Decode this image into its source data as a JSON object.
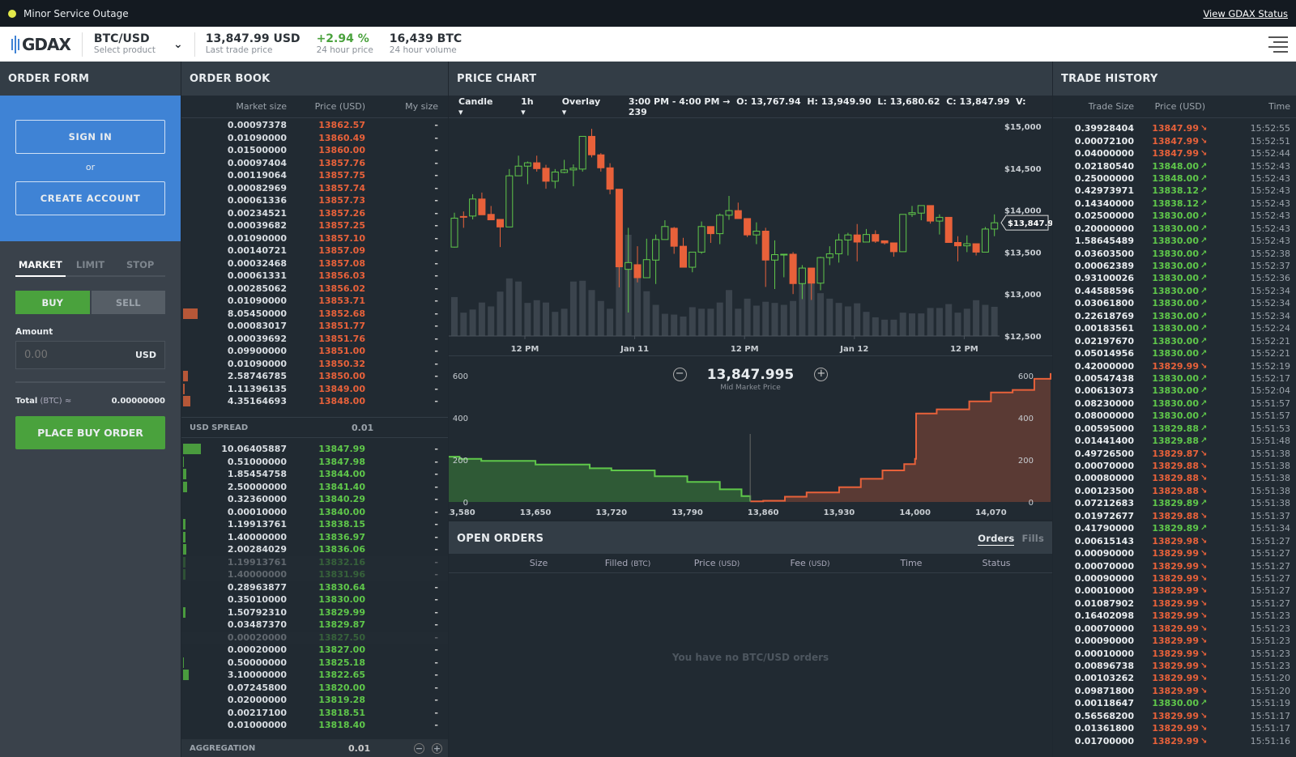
{
  "status": {
    "text": "Minor Service Outage",
    "link": "View GDAX Status",
    "dot_color": "#e3e94a"
  },
  "header": {
    "logo": "GDAX",
    "product": "BTC/USD",
    "product_sub": "Select product",
    "stats": [
      {
        "value": "13,847.99 USD",
        "label": "Last trade price"
      },
      {
        "value": "+2.94 %",
        "label": "24 hour price",
        "color": "#4aa23d"
      },
      {
        "value": "16,439 BTC",
        "label": "24 hour volume"
      }
    ]
  },
  "order_form": {
    "title": "ORDER FORM",
    "sign_in": "SIGN IN",
    "or": "or",
    "create_account": "CREATE ACCOUNT",
    "tabs": [
      "MARKET",
      "LIMIT",
      "STOP"
    ],
    "buy": "BUY",
    "sell": "SELL",
    "amount_label": "Amount",
    "amount_placeholder": "0.00",
    "amount_unit": "USD",
    "total_label": "Total",
    "total_unit": "(BTC) ≈",
    "total_value": "0.00000000",
    "place": "PLACE BUY ORDER"
  },
  "order_book": {
    "title": "ORDER BOOK",
    "headers": [
      "Market size",
      "Price (USD)",
      "My size"
    ],
    "asks": [
      {
        "size": "0.00097378",
        "price": "13862.57"
      },
      {
        "size": "0.01090000",
        "price": "13860.49"
      },
      {
        "size": "0.01500000",
        "price": "13860.00"
      },
      {
        "size": "0.00097404",
        "price": "13857.76"
      },
      {
        "size": "0.00119064",
        "price": "13857.75"
      },
      {
        "size": "0.00082969",
        "price": "13857.74"
      },
      {
        "size": "0.00061336",
        "price": "13857.73"
      },
      {
        "size": "0.00234521",
        "price": "13857.26"
      },
      {
        "size": "0.00039682",
        "price": "13857.25"
      },
      {
        "size": "0.01090000",
        "price": "13857.10"
      },
      {
        "size": "0.00140721",
        "price": "13857.09"
      },
      {
        "size": "0.00032468",
        "price": "13857.08"
      },
      {
        "size": "0.00061331",
        "price": "13856.03"
      },
      {
        "size": "0.00285062",
        "price": "13856.02"
      },
      {
        "size": "0.01090000",
        "price": "13853.71"
      },
      {
        "size": "8.05450000",
        "price": "13852.68"
      },
      {
        "size": "0.00083017",
        "price": "13851.77"
      },
      {
        "size": "0.00039692",
        "price": "13851.76"
      },
      {
        "size": "0.09900000",
        "price": "13851.00"
      },
      {
        "size": "0.01090000",
        "price": "13850.32"
      },
      {
        "size": "2.58746785",
        "price": "13850.00"
      },
      {
        "size": "1.11396135",
        "price": "13849.00"
      },
      {
        "size": "4.35164693",
        "price": "13848.00"
      }
    ],
    "spread_label": "USD SPREAD",
    "spread": "0.01",
    "bids": [
      {
        "size": "10.06405887",
        "price": "13847.99"
      },
      {
        "size": "0.51000000",
        "price": "13847.98"
      },
      {
        "size": "1.85454758",
        "price": "13844.00"
      },
      {
        "size": "2.50000000",
        "price": "13841.40"
      },
      {
        "size": "0.32360000",
        "price": "13840.29"
      },
      {
        "size": "0.00010000",
        "price": "13840.00"
      },
      {
        "size": "1.19913761",
        "price": "13838.15"
      },
      {
        "size": "1.40000000",
        "price": "13836.97"
      },
      {
        "size": "2.00284029",
        "price": "13836.06"
      },
      {
        "size": "1.19913761",
        "price": "13832.16",
        "faded": true
      },
      {
        "size": "1.40000000",
        "price": "13831.96",
        "faded": true
      },
      {
        "size": "0.28963877",
        "price": "13830.64"
      },
      {
        "size": "0.35010000",
        "price": "13830.00"
      },
      {
        "size": "1.50792310",
        "price": "13829.99"
      },
      {
        "size": "0.03487370",
        "price": "13829.87"
      },
      {
        "size": "0.00020000",
        "price": "13827.50",
        "faded": true
      },
      {
        "size": "0.00020000",
        "price": "13827.00"
      },
      {
        "size": "0.50000000",
        "price": "13825.18"
      },
      {
        "size": "3.10000000",
        "price": "13822.65"
      },
      {
        "size": "0.07245800",
        "price": "13820.00"
      },
      {
        "size": "0.02000000",
        "price": "13819.28"
      },
      {
        "size": "0.00217100",
        "price": "13818.51"
      },
      {
        "size": "0.01000000",
        "price": "13818.40"
      }
    ],
    "my_size": "-",
    "aggregation_label": "AGGREGATION",
    "aggregation": "0.01"
  },
  "price_chart": {
    "title": "PRICE CHART",
    "chart_type": "Candle",
    "interval": "1h",
    "overlay": "Overlay",
    "ohlc": {
      "range": "3:00 PM - 4:00 PM →",
      "o": "O: 13,767.94",
      "h": "H: 13,949.90",
      "l": "L: 13,680.62",
      "c": "C: 13,847.99",
      "v": "V: 239"
    },
    "current_price_tag": "$13,847.99",
    "mid_price": "13,847.995",
    "mid_label": "Mid Market Price"
  },
  "chart_data": [
    {
      "type": "candlestick",
      "title": "PRICE CHART",
      "ylabel": "Price (USD)",
      "ylim": [
        12500,
        15000
      ],
      "y_ticks": [
        "$15,000",
        "$14,500",
        "$14,000",
        "$13,500",
        "$13,000",
        "$12,500"
      ],
      "x_ticks": [
        {
          "label": "12 PM",
          "at": 7.7
        },
        {
          "label": "Jan 11",
          "at": 19.7
        },
        {
          "label": "12 PM",
          "at": 31.7
        },
        {
          "label": "Jan 12",
          "at": 43.7
        },
        {
          "label": "12 PM",
          "at": 55.7
        }
      ],
      "candles": [
        [
          13560,
          13970,
          13555,
          13905
        ],
        [
          13925,
          13985,
          13790,
          13920
        ],
        [
          13930,
          14190,
          13890,
          14133
        ],
        [
          14133,
          14210,
          13945,
          13945
        ],
        [
          13950,
          14050,
          13885,
          13885
        ],
        [
          13890,
          13890,
          13560,
          13800
        ],
        [
          13800,
          14490,
          13800,
          14410
        ],
        [
          14410,
          14650,
          14410,
          14525
        ],
        [
          14525,
          14580,
          14310,
          14565
        ],
        [
          14565,
          14650,
          14460,
          14495
        ],
        [
          14500,
          14540,
          14255,
          14345
        ],
        [
          14345,
          14490,
          14260,
          14455
        ],
        [
          14450,
          14600,
          14440,
          14480
        ],
        [
          14480,
          14545,
          14285,
          14500
        ],
        [
          14490,
          14880,
          14460,
          14880
        ],
        [
          14880,
          14970,
          14630,
          14660
        ],
        [
          14660,
          14680,
          14460,
          14505
        ],
        [
          14505,
          14560,
          14190,
          14250
        ],
        [
          14250,
          14250,
          13080,
          13325
        ],
        [
          13295,
          13790,
          12780,
          13375
        ],
        [
          13350,
          13570,
          13140,
          13195
        ],
        [
          13195,
          13660,
          13195,
          13410
        ],
        [
          13405,
          13710,
          13120,
          13650
        ],
        [
          13650,
          13880,
          13650,
          13805
        ],
        [
          13785,
          13800,
          13480,
          13570
        ],
        [
          13570,
          13670,
          13320,
          13320
        ],
        [
          13320,
          13500,
          13260,
          13500
        ],
        [
          13500,
          13865,
          13480,
          13805
        ],
        [
          13805,
          13805,
          13610,
          13720
        ],
        [
          13720,
          13960,
          13595,
          13940
        ],
        [
          13940,
          14170,
          13885,
          13995
        ],
        [
          13995,
          14090,
          13900,
          13900
        ],
        [
          13900,
          13900,
          13680,
          13705
        ],
        [
          13705,
          13855,
          13595,
          13750
        ],
        [
          13750,
          13790,
          13085,
          13405
        ],
        [
          13405,
          13640,
          13060,
          13470
        ],
        [
          13470,
          13475,
          13200,
          13475
        ],
        [
          13475,
          13500,
          13000,
          13125
        ],
        [
          13125,
          13345,
          12940,
          13310
        ],
        [
          13310,
          13310,
          12930,
          13130
        ],
        [
          13130,
          13445,
          13045,
          13435
        ],
        [
          13435,
          13570,
          13345,
          13480
        ],
        [
          13480,
          13720,
          13375,
          13645
        ],
        [
          13645,
          13730,
          13460,
          13705
        ],
        [
          13705,
          13835,
          13390,
          13620
        ],
        [
          13620,
          13775,
          13620,
          13710
        ],
        [
          13710,
          13760,
          13610,
          13630
        ],
        [
          13635,
          13630,
          13590,
          13610
        ],
        [
          13610,
          13610,
          13445,
          13505
        ],
        [
          13505,
          13950,
          13505,
          13950
        ],
        [
          13950,
          14050,
          13920,
          13970
        ],
        [
          13965,
          14055,
          13880,
          14055
        ],
        [
          14055,
          14055,
          13840,
          13870
        ],
        [
          13870,
          13950,
          13710,
          13915
        ],
        [
          13915,
          13915,
          13615,
          13615
        ],
        [
          13615,
          13690,
          13390,
          13575
        ],
        [
          13575,
          13700,
          13500,
          13600
        ],
        [
          13600,
          13600,
          13460,
          13500
        ],
        [
          13500,
          13800,
          13500,
          13775
        ],
        [
          13775,
          13950,
          13690,
          13850
        ]
      ],
      "volume": [
        100,
        60,
        68,
        86,
        76,
        114,
        148,
        140,
        85,
        92,
        86,
        62,
        70,
        140,
        142,
        118,
        90,
        70,
        255,
        260,
        170,
        115,
        80,
        57,
        55,
        50,
        74,
        70,
        70,
        86,
        118,
        70,
        96,
        78,
        88,
        85,
        80,
        90,
        136,
        136,
        110,
        96,
        85,
        76,
        84,
        62,
        48,
        42,
        42,
        60,
        58,
        58,
        72,
        72,
        82,
        60,
        70,
        92,
        80,
        75
      ]
    },
    {
      "type": "area",
      "title": "Depth chart",
      "xlabel": "Price (USD)",
      "xlim": [
        13570,
        14125
      ],
      "ylim": [
        0,
        650
      ],
      "x_ticks": [
        "13,580",
        "13,650",
        "13,720",
        "13,790",
        "13,860",
        "13,930",
        "14,000",
        "14,070"
      ],
      "y_ticks": [
        "0",
        "200",
        "400",
        "600"
      ],
      "series": [
        {
          "name": "bids",
          "color": "#5fc74a",
          "points": [
            [
              13570,
              215
            ],
            [
              13580,
              205
            ],
            [
              13600,
              195
            ],
            [
              13650,
              178
            ],
            [
              13700,
              160
            ],
            [
              13720,
              150
            ],
            [
              13760,
              122
            ],
            [
              13790,
              95
            ],
            [
              13820,
              60
            ],
            [
              13840,
              28
            ],
            [
              13848,
              3
            ]
          ]
        },
        {
          "name": "asks",
          "color": "#e8613a",
          "points": [
            [
              13848,
              3
            ],
            [
              13860,
              6
            ],
            [
              13880,
              25
            ],
            [
              13900,
              45
            ],
            [
              13930,
              70
            ],
            [
              13950,
              110
            ],
            [
              13970,
              150
            ],
            [
              13990,
              180
            ],
            [
              14000,
              205
            ],
            [
              14001,
              420
            ],
            [
              14020,
              440
            ],
            [
              14050,
              478
            ],
            [
              14070,
              520
            ],
            [
              14090,
              532
            ],
            [
              14110,
              585
            ],
            [
              14125,
              612
            ]
          ]
        }
      ]
    }
  ],
  "open_orders": {
    "title": "OPEN ORDERS",
    "tabs": [
      "Orders",
      "Fills"
    ],
    "headers": [
      {
        "name": "Size",
        "unit": ""
      },
      {
        "name": "Filled",
        "unit": "(BTC)"
      },
      {
        "name": "Price",
        "unit": "(USD)"
      },
      {
        "name": "Fee",
        "unit": "(USD)"
      },
      {
        "name": "Time",
        "unit": ""
      },
      {
        "name": "Status",
        "unit": ""
      }
    ],
    "empty": "You have no BTC/USD orders"
  },
  "trade_history": {
    "title": "TRADE HISTORY",
    "headers": [
      "Trade Size",
      "Price (USD)",
      "Time"
    ],
    "trades": [
      [
        "0.39928404",
        "13847.99",
        "down",
        "15:52:55"
      ],
      [
        "0.00072100",
        "13847.99",
        "down",
        "15:52:51"
      ],
      [
        "0.04000000",
        "13847.99",
        "down",
        "15:52:44"
      ],
      [
        "0.02180540",
        "13848.00",
        "up",
        "15:52:43"
      ],
      [
        "0.25000000",
        "13848.00",
        "up",
        "15:52:43"
      ],
      [
        "0.42973971",
        "13838.12",
        "up",
        "15:52:43"
      ],
      [
        "0.14340000",
        "13838.12",
        "up",
        "15:52:43"
      ],
      [
        "0.02500000",
        "13830.00",
        "up",
        "15:52:43"
      ],
      [
        "0.20000000",
        "13830.00",
        "up",
        "15:52:43"
      ],
      [
        "1.58645489",
        "13830.00",
        "up",
        "15:52:43"
      ],
      [
        "0.03603500",
        "13830.00",
        "up",
        "15:52:38"
      ],
      [
        "0.00062389",
        "13830.00",
        "up",
        "15:52:37"
      ],
      [
        "0.93100026",
        "13830.00",
        "up",
        "15:52:36"
      ],
      [
        "0.44588596",
        "13830.00",
        "up",
        "15:52:34"
      ],
      [
        "0.03061800",
        "13830.00",
        "up",
        "15:52:34"
      ],
      [
        "0.22618769",
        "13830.00",
        "up",
        "15:52:34"
      ],
      [
        "0.00183561",
        "13830.00",
        "up",
        "15:52:24"
      ],
      [
        "0.02197670",
        "13830.00",
        "up",
        "15:52:21"
      ],
      [
        "0.05014956",
        "13830.00",
        "up",
        "15:52:21"
      ],
      [
        "0.42000000",
        "13829.99",
        "down",
        "15:52:19"
      ],
      [
        "0.00547438",
        "13830.00",
        "up",
        "15:52:17"
      ],
      [
        "0.00613073",
        "13830.00",
        "up",
        "15:52:04"
      ],
      [
        "0.08230000",
        "13830.00",
        "up",
        "15:51:57"
      ],
      [
        "0.08000000",
        "13830.00",
        "up",
        "15:51:57"
      ],
      [
        "0.00595000",
        "13829.88",
        "up",
        "15:51:53"
      ],
      [
        "0.01441400",
        "13829.88",
        "up",
        "15:51:48"
      ],
      [
        "0.49726500",
        "13829.87",
        "down",
        "15:51:38"
      ],
      [
        "0.00070000",
        "13829.88",
        "down",
        "15:51:38"
      ],
      [
        "0.00080000",
        "13829.88",
        "down",
        "15:51:38"
      ],
      [
        "0.00123500",
        "13829.88",
        "down",
        "15:51:38"
      ],
      [
        "0.07212683",
        "13829.89",
        "up",
        "15:51:38"
      ],
      [
        "0.01972677",
        "13829.88",
        "down",
        "15:51:37"
      ],
      [
        "0.41790000",
        "13829.89",
        "up",
        "15:51:34"
      ],
      [
        "0.00615143",
        "13829.98",
        "down",
        "15:51:27"
      ],
      [
        "0.00090000",
        "13829.99",
        "down",
        "15:51:27"
      ],
      [
        "0.00070000",
        "13829.99",
        "down",
        "15:51:27"
      ],
      [
        "0.00090000",
        "13829.99",
        "down",
        "15:51:27"
      ],
      [
        "0.00010000",
        "13829.99",
        "down",
        "15:51:27"
      ],
      [
        "0.01087902",
        "13829.99",
        "down",
        "15:51:27"
      ],
      [
        "0.16402098",
        "13829.99",
        "down",
        "15:51:23"
      ],
      [
        "0.00070000",
        "13829.99",
        "down",
        "15:51:23"
      ],
      [
        "0.00090000",
        "13829.99",
        "down",
        "15:51:23"
      ],
      [
        "0.00010000",
        "13829.99",
        "down",
        "15:51:23"
      ],
      [
        "0.00896738",
        "13829.99",
        "down",
        "15:51:23"
      ],
      [
        "0.00103262",
        "13829.99",
        "down",
        "15:51:20"
      ],
      [
        "0.09871800",
        "13829.99",
        "down",
        "15:51:20"
      ],
      [
        "0.00118647",
        "13830.00",
        "up",
        "15:51:19"
      ],
      [
        "0.56568200",
        "13829.99",
        "down",
        "15:51:17"
      ],
      [
        "0.01361800",
        "13829.99",
        "down",
        "15:51:17"
      ],
      [
        "0.01700000",
        "13829.99",
        "down",
        "15:51:16"
      ]
    ]
  },
  "colors": {
    "up": "#5fc74a",
    "down": "#e8613a",
    "accent": "#3f83d5",
    "buy": "#4aa23d"
  }
}
